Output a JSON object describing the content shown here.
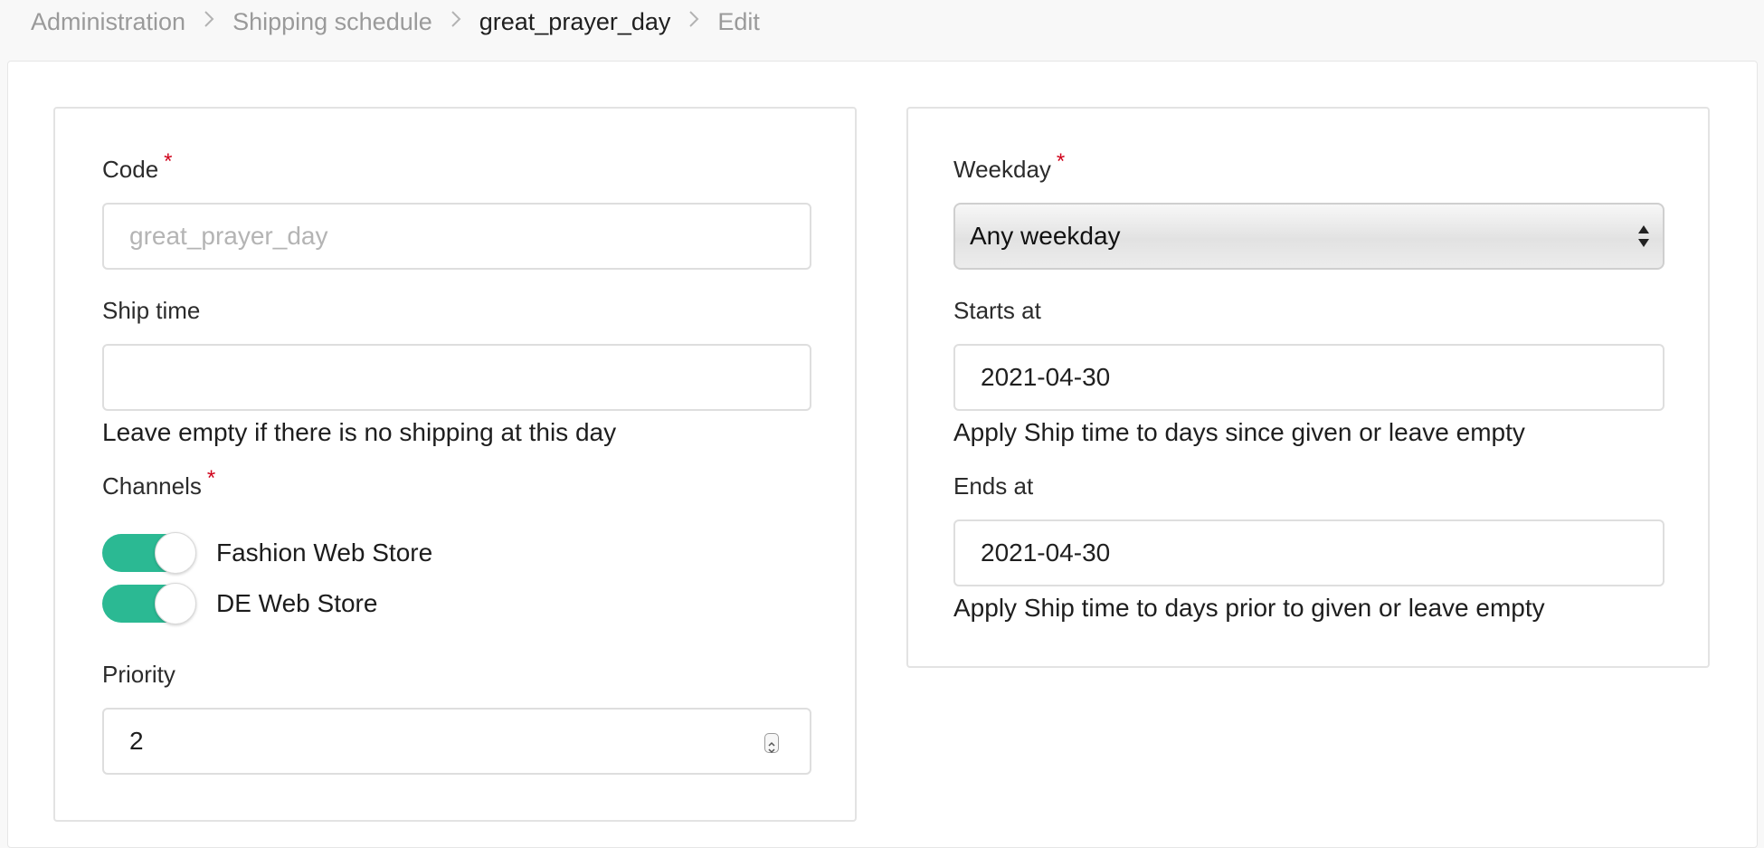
{
  "breadcrumb": {
    "items": [
      "Administration",
      "Shipping schedule",
      "great_prayer_day",
      "Edit"
    ],
    "separator": ">"
  },
  "form": {
    "code": {
      "label": "Code",
      "required_mark": "*",
      "value": "great_prayer_day"
    },
    "ship_time": {
      "label": "Ship time",
      "value": "",
      "help": "Leave empty if there is no shipping at this day"
    },
    "channels": {
      "label": "Channels",
      "required_mark": "*",
      "items": [
        {
          "label": "Fashion Web Store",
          "enabled": true
        },
        {
          "label": "DE Web Store",
          "enabled": true
        }
      ]
    },
    "priority": {
      "label": "Priority",
      "value": "2"
    },
    "weekday": {
      "label": "Weekday",
      "required_mark": "*",
      "selected": "Any weekday"
    },
    "starts_at": {
      "label": "Starts at",
      "value": "2021-04-30",
      "help": "Apply Ship time to days since given or leave empty"
    },
    "ends_at": {
      "label": "Ends at",
      "value": "2021-04-30",
      "help": "Apply Ship time to days prior to given or leave empty"
    }
  },
  "colors": {
    "toggle_on": "#2bb993",
    "required": "#d0021b",
    "background": "#f8f8f8"
  },
  "icons": {
    "breadcrumb_separator": "chevron-right-icon",
    "select_arrows": "select-arrows-icon",
    "number_stepper": "stepper-icon"
  }
}
